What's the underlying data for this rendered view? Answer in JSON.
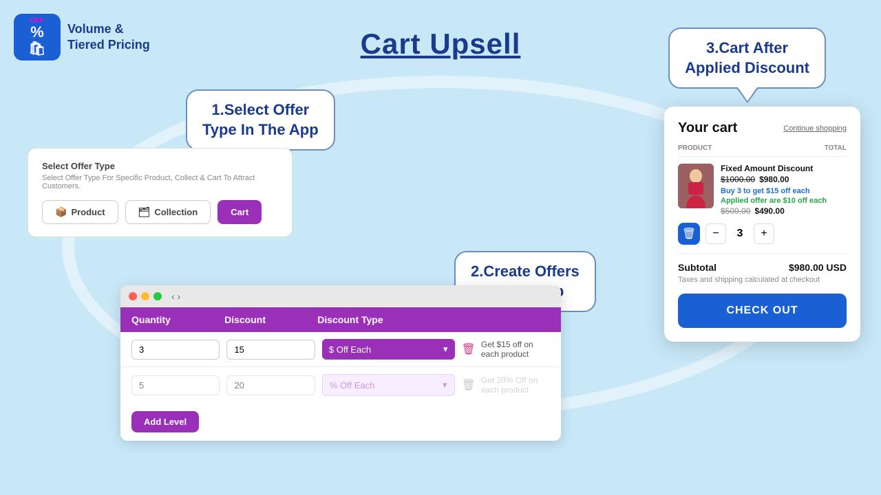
{
  "logo": {
    "percent": "%",
    "off": "OFF",
    "bag": "🛍",
    "line1": "Volume &",
    "line2": "Tiered Pricing"
  },
  "page_title": "Cart Upsell",
  "bubble_step1": {
    "line1": "1.Select Offer",
    "line2": "Type In The App"
  },
  "offer_type_card": {
    "title": "Select Offer Type",
    "description": "Select Offer Type For Specific Product, Collect & Cart To Attract Customers.",
    "buttons": [
      {
        "label": "Product",
        "icon": "📦",
        "active": false
      },
      {
        "label": "Collection",
        "icon": "🗂",
        "active": false
      },
      {
        "label": "Cart",
        "active": true
      }
    ]
  },
  "bubble_step2": {
    "line1": "2.Create Offers",
    "line2": "In The App"
  },
  "editor": {
    "columns": [
      "Quantity",
      "Discount",
      "Discount Type",
      ""
    ],
    "rows": [
      {
        "qty": "3",
        "discount": "15",
        "type": "$ Off Each",
        "description": "Get $15 off on each product",
        "active": true
      },
      {
        "qty": "5",
        "discount": "20",
        "type": "% Off Each",
        "description": "Get 20% Off on each product",
        "active": false
      }
    ],
    "add_level_label": "Add Level"
  },
  "bubble_cart_after": {
    "line1": "3.Cart After",
    "line2": "Applied Discount"
  },
  "cart": {
    "title": "Your cart",
    "continue_shopping": "Continue shopping",
    "col_product": "PRODUCT",
    "col_total": "TOTAL",
    "product": {
      "name": "Fixed Amount Discount",
      "original_price": "$1000.00",
      "discounted_price": "$980.00",
      "promo": "Buy 3 to get $15 off each",
      "applied": "Applied offer are $10 off each",
      "before_discount": "$500.00",
      "after_discount": "$490.00"
    },
    "quantity": 3,
    "subtotal_label": "Subtotal",
    "subtotal_value": "$980.00 USD",
    "tax_note": "Taxes and shipping calculated at checkout",
    "checkout_label": "CHECK OUT"
  }
}
